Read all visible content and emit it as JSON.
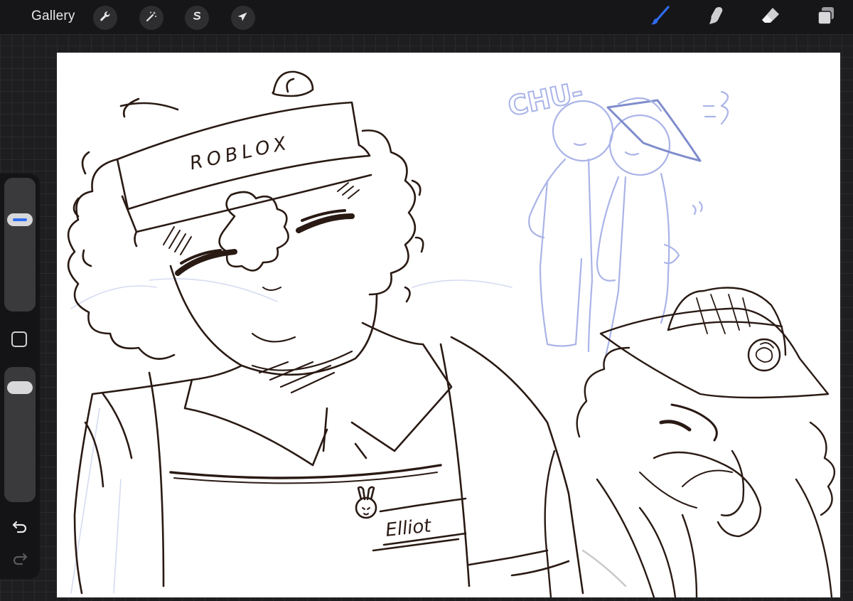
{
  "toolbar": {
    "gallery_label": "Gallery",
    "left_tools": [
      {
        "name": "actions",
        "icon": "wrench-icon"
      },
      {
        "name": "adjustments",
        "icon": "magic-wand-icon"
      },
      {
        "name": "selection",
        "icon": "selection-s-icon"
      },
      {
        "name": "transform",
        "icon": "arrow-cursor-icon"
      }
    ],
    "right_tools": [
      {
        "name": "brush",
        "icon": "brush-icon",
        "active": true
      },
      {
        "name": "smudge",
        "icon": "smudge-finger-icon",
        "active": false
      },
      {
        "name": "eraser",
        "icon": "eraser-icon",
        "active": false
      },
      {
        "name": "layers",
        "icon": "layers-icon",
        "active": false
      }
    ],
    "active_color": "#2f6cf0"
  },
  "sidebar": {
    "brush_size_level": 0.27,
    "opacity_level": 0.08,
    "controls": [
      "brush-size-slider",
      "modify-button",
      "opacity-slider",
      "undo-button",
      "redo-button"
    ]
  },
  "artwork": {
    "cap_text": "ROBLOX",
    "name_tag": "Elliot",
    "sketch_text": "CHU-",
    "ink_color": "#2a1a14",
    "sketch_color": "#aab4e8"
  }
}
